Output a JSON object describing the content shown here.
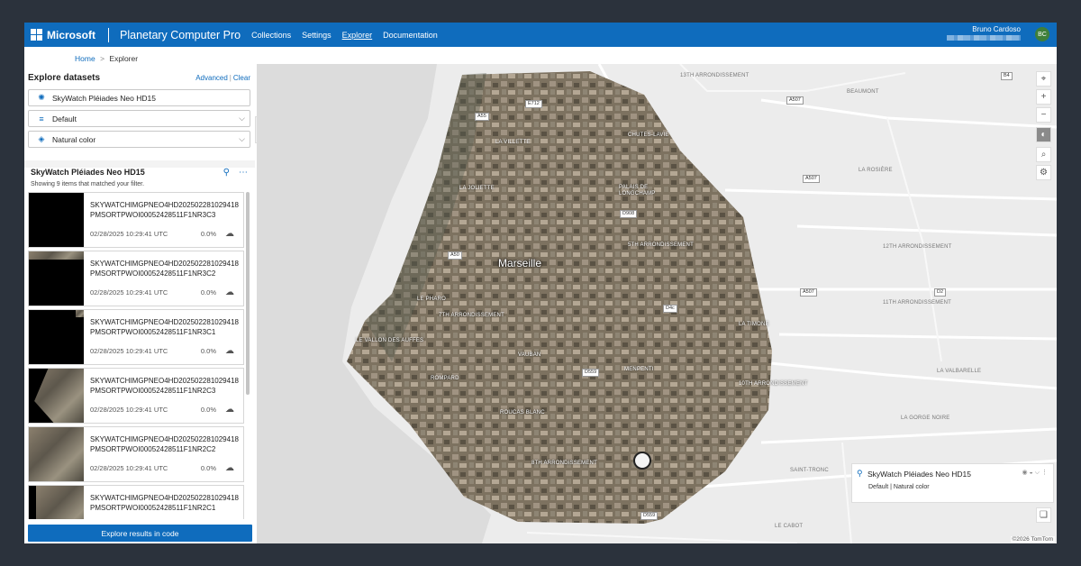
{
  "topbar": {
    "brand": "Microsoft",
    "product": "Planetary Computer Pro",
    "nav": [
      {
        "label": "Collections",
        "active": false
      },
      {
        "label": "Settings",
        "active": false
      },
      {
        "label": "Explorer",
        "active": true
      },
      {
        "label": "Documentation",
        "active": false
      }
    ],
    "user_name": "Bruno Cardoso",
    "avatar_initials": "BC",
    "accent": "#0f6cbd"
  },
  "breadcrumb": {
    "home": "Home",
    "separator": ">",
    "current": "Explorer"
  },
  "explore": {
    "title": "Explore datasets",
    "advanced": "Advanced",
    "clear": "Clear",
    "dataset": "SkyWatch Pléiades Neo HD15",
    "filter": "Default",
    "render": "Natural color"
  },
  "results": {
    "title": "SkyWatch Pléiades Neo HD15",
    "showing": "Showing 9 items that matched your filter.",
    "items": [
      {
        "id": "SKYWATCHIMGPNEO4HD202502281029418PMSORTPWOI00052428511F1NR3C3",
        "date": "02/28/2025 10:29:41 UTC",
        "cloud": "0.0%"
      },
      {
        "id": "SKYWATCHIMGPNEO4HD202502281029418PMSORTPWOI00052428511F1NR3C2",
        "date": "02/28/2025 10:29:41 UTC",
        "cloud": "0.0%"
      },
      {
        "id": "SKYWATCHIMGPNEO4HD202502281029418PMSORTPWOI00052428511F1NR3C1",
        "date": "02/28/2025 10:29:41 UTC",
        "cloud": "0.0%"
      },
      {
        "id": "SKYWATCHIMGPNEO4HD202502281029418PMSORTPWOI00052428511F1NR2C3",
        "date": "02/28/2025 10:29:41 UTC",
        "cloud": "0.0%"
      },
      {
        "id": "SKYWATCHIMGPNEO4HD202502281029418PMSORTPWOI00052428511F1NR2C2",
        "date": "02/28/2025 10:29:41 UTC",
        "cloud": "0.0%"
      },
      {
        "id": "SKYWATCHIMGPNEO4HD202502281029418PMSORTPWOI00052428511F1NR2C1",
        "date": "",
        "cloud": ""
      }
    ],
    "code_button": "Explore results in code"
  },
  "map": {
    "city": "Marseille",
    "labels": [
      "13TH ARRONDISSEMENT",
      "BEAUMONT",
      "LA ROSIÈRE",
      "12TH ARRONDISSEMENT",
      "11TH ARRONDISSEMENT",
      "LA VALBARELLE",
      "LA GORGE NOIRE",
      "SAINT-TRONC",
      "LE CABOT",
      "CHUTES-LAVIE",
      "LA VILLETTE",
      "LA JOLIETTE",
      "PALAIS DE LONGCHAMP",
      "5TH ARRONDISSEMENT",
      "LE PHARO",
      "7TH ARRONDISSEMENT",
      "LE VALLON DES AUFFES",
      "VAUBAN",
      "LA TIMONE",
      "MENPENTI",
      "ROMPARD",
      "ROUCAS BLANC",
      "8TH ARRONDISSEMENT",
      "10TH ARRONDISSEMENT"
    ],
    "shields": [
      "B4",
      "A507",
      "A55",
      "E712",
      "A507",
      "D908",
      "A50",
      "A507",
      "D2",
      "D4c",
      "D559",
      "D559"
    ],
    "legend": {
      "title": "SkyWatch Pléiades Neo HD15",
      "subtitle": "Default | Natural color"
    },
    "copyright": "©2026 TomTom"
  }
}
